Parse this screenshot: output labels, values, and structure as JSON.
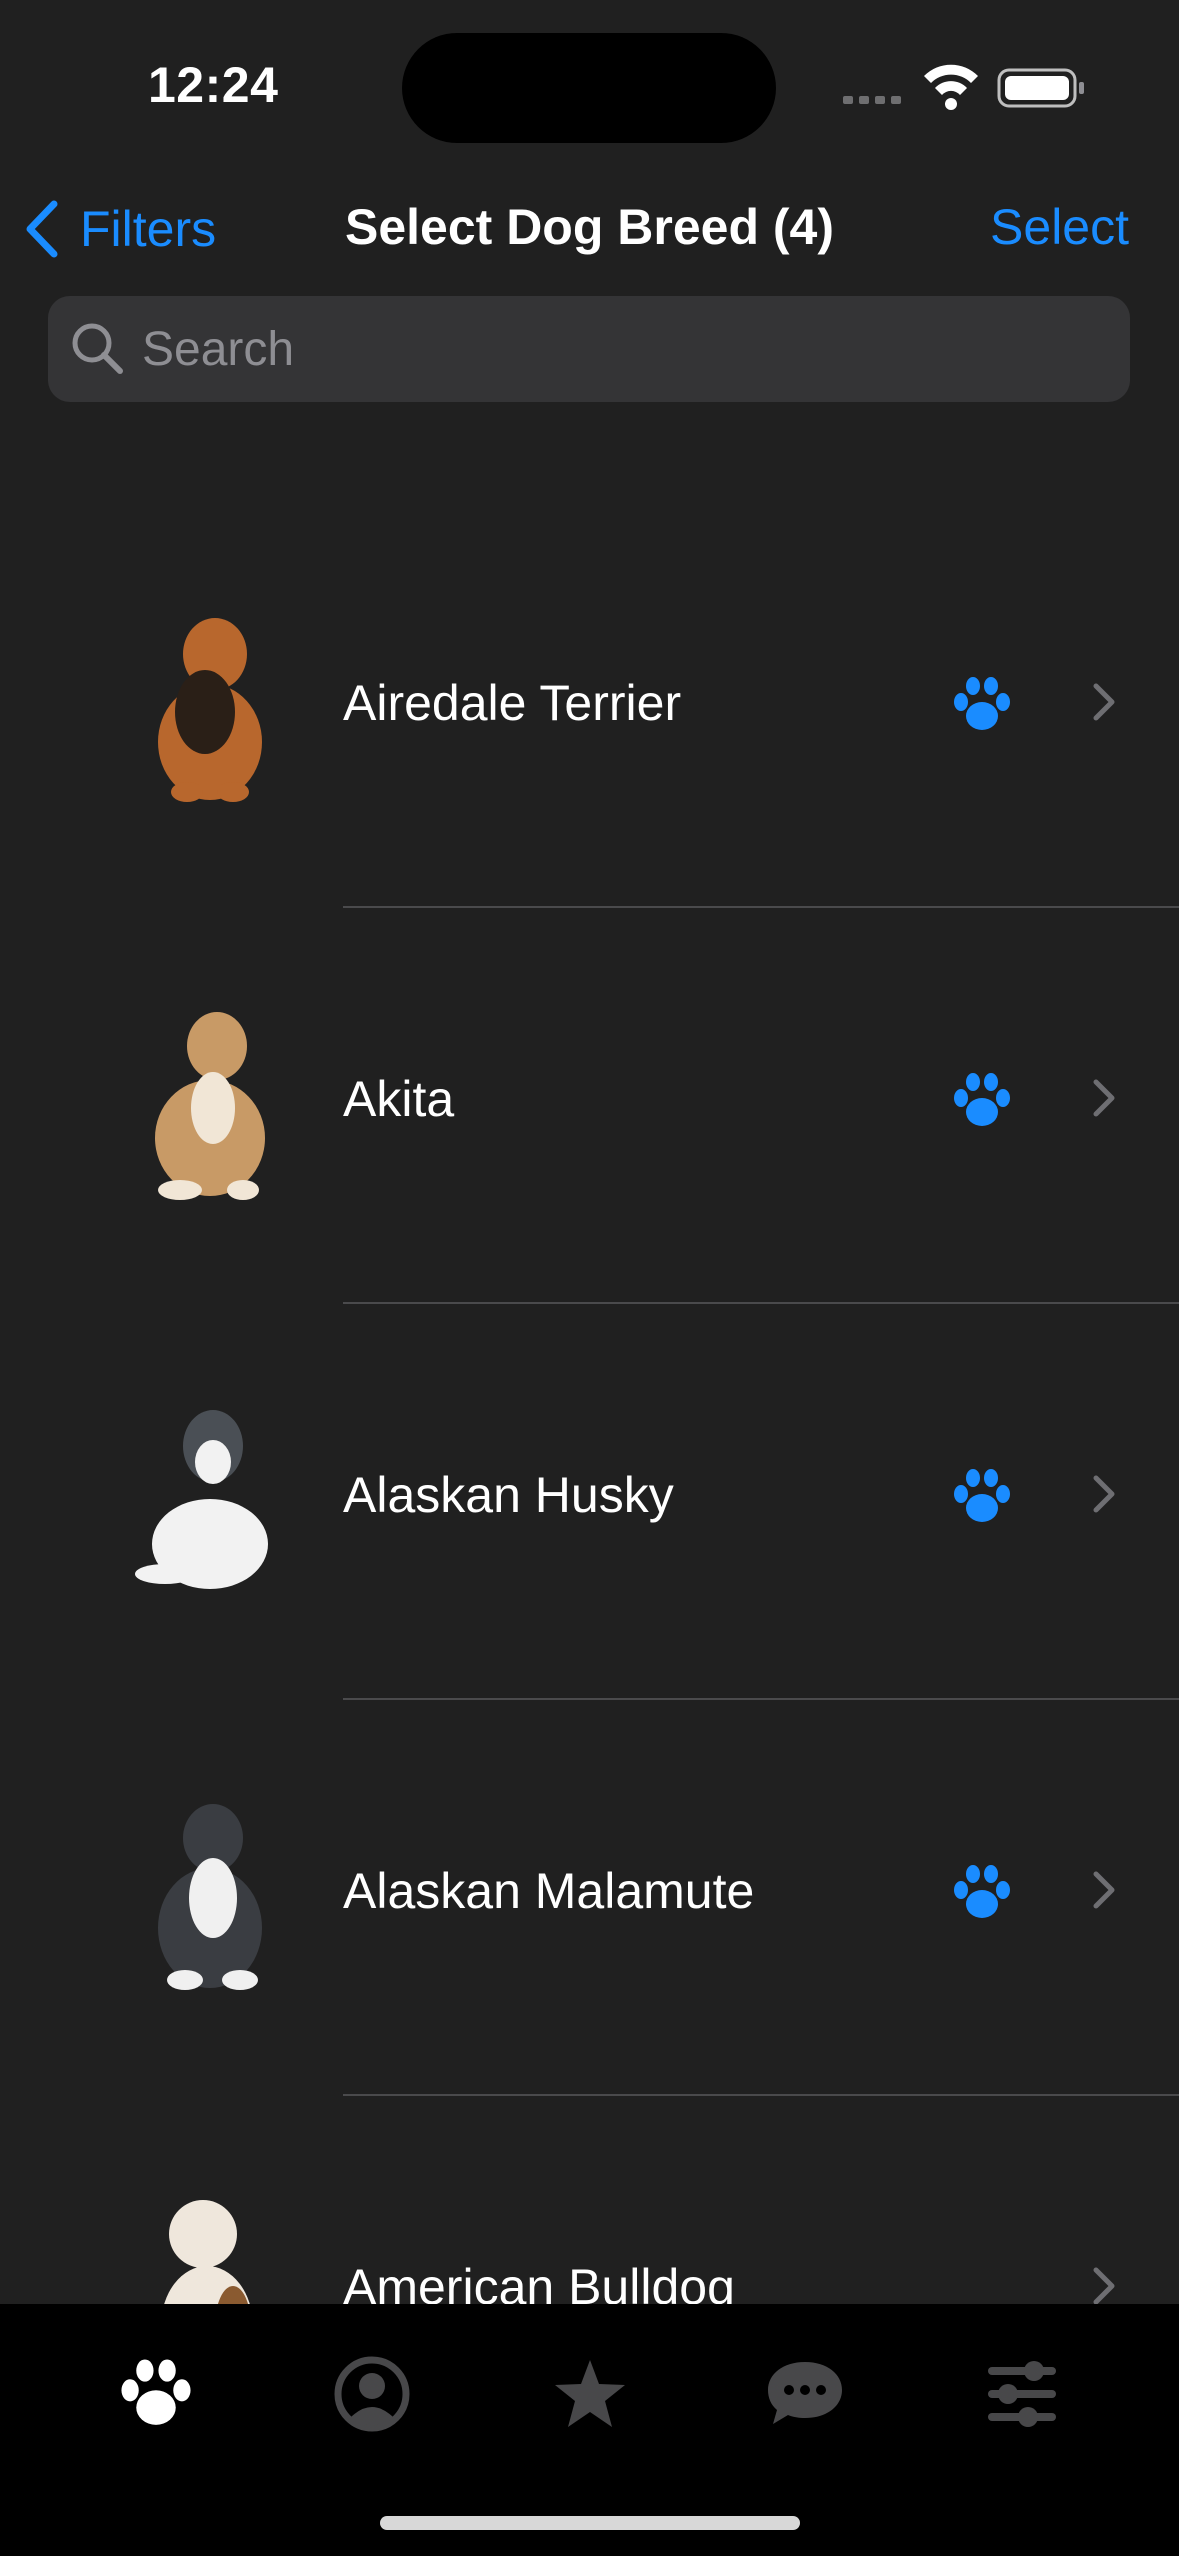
{
  "status_bar": {
    "time": "12:24"
  },
  "nav": {
    "back_label": "Filters",
    "title": "Select Dog Breed (4)",
    "action_label": "Select"
  },
  "search": {
    "placeholder": "Search"
  },
  "breeds": [
    {
      "name": "Airedale Terrier",
      "icon": "paw-icon",
      "dog_colors": [
        "#b8672d",
        "#2a1f17"
      ]
    },
    {
      "name": "Akita",
      "icon": "paw-icon",
      "dog_colors": [
        "#c89a66",
        "#f1e6d6"
      ]
    },
    {
      "name": "Alaskan Husky",
      "icon": "paw-icon",
      "dog_colors": [
        "#f2f2f2",
        "#4a4f55"
      ]
    },
    {
      "name": "Alaskan Malamute",
      "icon": "paw-icon",
      "dog_colors": [
        "#3a3d42",
        "#f0f0f0"
      ]
    },
    {
      "name": "American Bulldog",
      "icon": "paw-icon",
      "dog_colors": [
        "#efe7dc",
        "#8a5a30"
      ]
    }
  ],
  "tabs": [
    {
      "name": "paw-icon",
      "active": true
    },
    {
      "name": "profile-icon",
      "active": false
    },
    {
      "name": "star-icon",
      "active": false
    },
    {
      "name": "chat-icon",
      "active": false
    },
    {
      "name": "sliders-icon",
      "active": false
    }
  ],
  "colors": {
    "accent": "#1a8cff",
    "background": "#202020",
    "tab_active": "#ffffff",
    "tab_inactive": "#48484a"
  }
}
